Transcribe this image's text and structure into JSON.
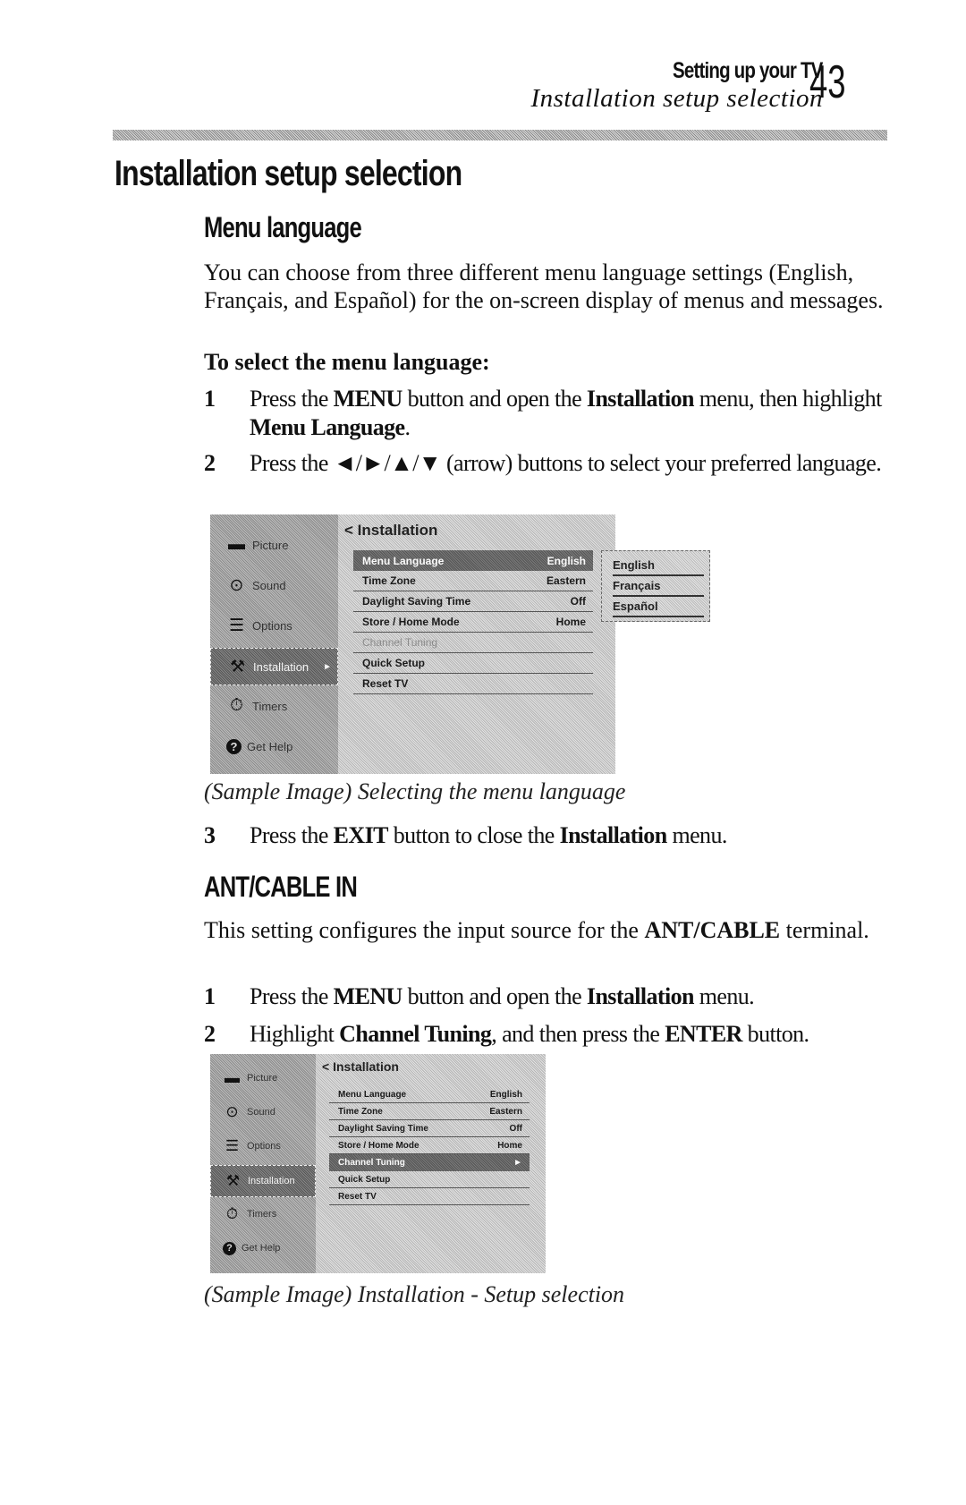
{
  "header": {
    "chapter": "Setting up your TV",
    "section": "Installation setup selection",
    "page_number": "43"
  },
  "title": "Installation setup selection",
  "menu_language": {
    "heading": "Menu language",
    "intro": "You can choose from three different menu language settings (English, Français, and Español) for the on-screen display of menus and messages.",
    "procedure_title": "To select the menu language:",
    "steps": [
      {
        "num": "1",
        "parts": [
          [
            "Press the ",
            false
          ],
          [
            "MENU",
            true
          ],
          [
            " button and open the ",
            false
          ],
          [
            "Installation",
            true
          ],
          [
            " menu, then highlight ",
            false
          ],
          [
            "Menu Language",
            true
          ],
          [
            ".",
            false
          ]
        ]
      },
      {
        "num": "2",
        "parts": [
          [
            "Press the ◄/►/▲/▼ (arrow) buttons to select your preferred language.",
            false
          ]
        ]
      },
      {
        "num": "3",
        "parts": [
          [
            "Press the ",
            false
          ],
          [
            "EXIT",
            true
          ],
          [
            " button to close the ",
            false
          ],
          [
            "Installation",
            true
          ],
          [
            " menu.",
            false
          ]
        ]
      }
    ],
    "caption": "(Sample Image) Selecting the menu language"
  },
  "ant_cable": {
    "heading": "ANT/CABLE IN",
    "intro_parts": [
      [
        "This setting configures the input source for the ",
        false
      ],
      [
        "ANT/CABLE",
        true
      ],
      [
        " terminal.",
        false
      ]
    ],
    "steps": [
      {
        "num": "1",
        "parts": [
          [
            "Press the ",
            false
          ],
          [
            "MENU",
            true
          ],
          [
            " button and open the ",
            false
          ],
          [
            "Installation",
            true
          ],
          [
            " menu.",
            false
          ]
        ]
      },
      {
        "num": "2",
        "parts": [
          [
            "Highlight ",
            false
          ],
          [
            "Channel Tuning",
            true
          ],
          [
            ", and then press the ",
            false
          ],
          [
            "ENTER",
            true
          ],
          [
            " button.",
            false
          ]
        ]
      }
    ],
    "caption": "(Sample Image) Installation - Setup selection"
  },
  "tv_menu": {
    "sidebar": [
      {
        "label": "Picture",
        "icon": "tv-icon"
      },
      {
        "label": "Sound",
        "icon": "speaker-icon"
      },
      {
        "label": "Options",
        "icon": "options-icon"
      },
      {
        "label": "Installation",
        "icon": "tools-icon",
        "arrow": "►"
      },
      {
        "label": "Timers",
        "icon": "timer-icon"
      },
      {
        "label": "Get Help",
        "icon": "help-icon"
      }
    ],
    "title": "< Installation",
    "items": [
      {
        "label": "Menu Language",
        "value": "English"
      },
      {
        "label": "Time Zone",
        "value": "Eastern"
      },
      {
        "label": "Daylight Saving Time",
        "value": "Off"
      },
      {
        "label": "Store / Home Mode",
        "value": "Home"
      },
      {
        "label": "Channel Tuning",
        "value": ""
      },
      {
        "label": "Quick Setup",
        "value": ""
      },
      {
        "label": "Reset TV",
        "value": ""
      }
    ],
    "languages": [
      "English",
      "Français",
      "Español"
    ],
    "channel_tuning_arrow": "►"
  }
}
